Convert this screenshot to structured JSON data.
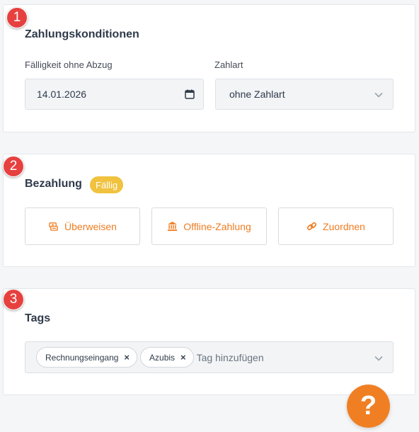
{
  "steps": [
    "1",
    "2",
    "3"
  ],
  "payment_terms": {
    "title": "Zahlungskonditionen",
    "due_label": "Fälligkeit ohne Abzug",
    "due_value": "14.01.2026",
    "method_label": "Zahlart",
    "method_value": "ohne Zahlart"
  },
  "payment": {
    "title": "Bezahlung",
    "status": "Fällig",
    "status_color": "#f0c23e",
    "buttons": {
      "transfer": "Überweisen",
      "offline": "Offline-Zahlung",
      "assign": "Zuordnen"
    },
    "accent_color": "#ef7d22"
  },
  "tags": {
    "title": "Tags",
    "items": [
      "Rechnungseingang",
      "Azubis"
    ],
    "remove_symbol": "×",
    "placeholder": "Tag hinzufügen"
  },
  "help": {
    "label": "?",
    "color": "#f07f24"
  },
  "icons": {
    "transfer": "money-transfer-icon",
    "offline": "bank-icon",
    "assign": "link-icon",
    "date": "calendar-icon",
    "dropdown": "chevron-down-icon"
  }
}
